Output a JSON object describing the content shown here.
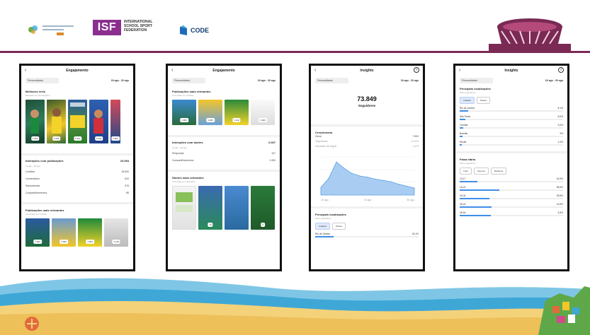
{
  "colors": {
    "header_line": "#7a2a54",
    "isf_purple": "#8b2f8f",
    "code_blue": "#1e6bb8",
    "chart_blue": "#3f8ee8",
    "footer_sand": "#f3d27a",
    "footer_sea": "#3fa7d6"
  },
  "header": {
    "logo_isf": "ISF",
    "isf_tagline": "INTERNATIONAL SCHOOL SPORT FEDERATION",
    "logo_code": "CODE"
  },
  "phones": [
    {
      "title": "Engajamento",
      "filter": "Personalizado",
      "range": "18 ago - 30 ago",
      "section1_title": "Melhores reels",
      "section1_sub": "Baseado em reproduções",
      "reels_badges": [
        "1.003",
        "1.003",
        "1.112",
        "1.003",
        "1.003"
      ],
      "section2_title": "Interações com publicações",
      "section2_value": "23.094",
      "section2_sub": "11 ago - 20 ago",
      "rows": [
        {
          "label": "Curtidas",
          "value": "18.500"
        },
        {
          "label": "Comentários",
          "value": "543"
        },
        {
          "label": "Salvamentos",
          "value": "578"
        },
        {
          "label": "Compartilhamentos",
          "value": "88"
        }
      ],
      "section3_title": "Publicações mais relevantes",
      "section3_sub": "Com base em curtidas",
      "bottom_badges": [
        "1.003",
        "1.003",
        "1.003",
        "1.118"
      ]
    },
    {
      "title": "Engajamento",
      "filter": "Personalizado",
      "range": "18 ago - 30 ago",
      "section1_title": "Publicações mais relevantes",
      "section1_sub": "Com base em curtidas",
      "post_badges": [
        "1.003",
        "1.003",
        "1.112",
        "1.003"
      ],
      "section2_title": "Interações com stories",
      "section2_value": "2.007",
      "section2_sub": "11 ago - 20 ago",
      "rows": [
        {
          "label": "Respostas",
          "value": "107"
        },
        {
          "label": "Compartilhamentos",
          "value": "1.900"
        }
      ],
      "section3_title": "Stories mais relevantes",
      "section3_sub": "Com base em respostas",
      "story_badges": [
        "",
        "14",
        "",
        "6"
      ]
    },
    {
      "title": "Insights",
      "filter": "Personalizado",
      "range": "18 ago - 30 ago",
      "big_number": "73.849",
      "big_label": "Seguidores",
      "section1_title": "Crescimento",
      "rows": [
        {
          "label": "Geral",
          "value": "7.500"
        },
        {
          "label": "Seguidores",
          "value": "11.973"
        },
        {
          "label": "Deixaram de seguir",
          "value": "1.473"
        }
      ],
      "chart_data": {
        "type": "area",
        "x": [
          "18 ago",
          "19 ago",
          "20 ago",
          "21 ago",
          "22 ago",
          "23 ago",
          "24 ago",
          "25 ago",
          "26 ago",
          "27 ago",
          "28 ago",
          "29 ago",
          "30 ago"
        ],
        "values": [
          120,
          260,
          520,
          420,
          340,
          300,
          280,
          250,
          230,
          210,
          170,
          140,
          110
        ],
        "x_ticks": [
          "18 ago",
          "24 ago",
          "30 ago"
        ],
        "ylim": [
          0,
          600
        ]
      },
      "section2_title": "Principais localizações",
      "section2_sub": "Seus seguidores",
      "tab1": "Cidades",
      "tab2": "Países",
      "last_row_label": "Rio de Janeiro",
      "last_row_value": "18,1%"
    },
    {
      "title": "Insights",
      "filter": "Personalizado",
      "range": "18 ago - 30 ago",
      "section1_title": "Principais localizações",
      "section1_sub": "Seus seguidores",
      "tab1": "Cidades",
      "tab2": "Países",
      "locations": [
        {
          "label": "Rio de Janeiro",
          "value": "8,1%",
          "pct": 0.08
        },
        {
          "label": "São Paulo",
          "value": "5,6%",
          "pct": 0.056
        },
        {
          "label": "Curitiba",
          "value": "3,6%",
          "pct": 0.036
        },
        {
          "label": "Brasília",
          "value": "3%",
          "pct": 0.03
        },
        {
          "label": "Recife",
          "value": "1,9%",
          "pct": 0.019
        }
      ],
      "section2_title": "Faixa etária",
      "section2_sub": "Seus seguidores",
      "age_tabs": [
        "Tudo",
        "Homens",
        "Mulheres"
      ],
      "ages": [
        {
          "label": "13-17",
          "value": "16,9%",
          "pct": 0.169
        },
        {
          "label": "18-24",
          "value": "38,5%",
          "pct": 0.385
        },
        {
          "label": "25-34",
          "value": "28,5%",
          "pct": 0.285
        },
        {
          "label": "35-44",
          "value": "10,6%",
          "pct": 0.306
        },
        {
          "label": "45-54",
          "value": "4,8%",
          "pct": 0.298
        }
      ]
    }
  ]
}
